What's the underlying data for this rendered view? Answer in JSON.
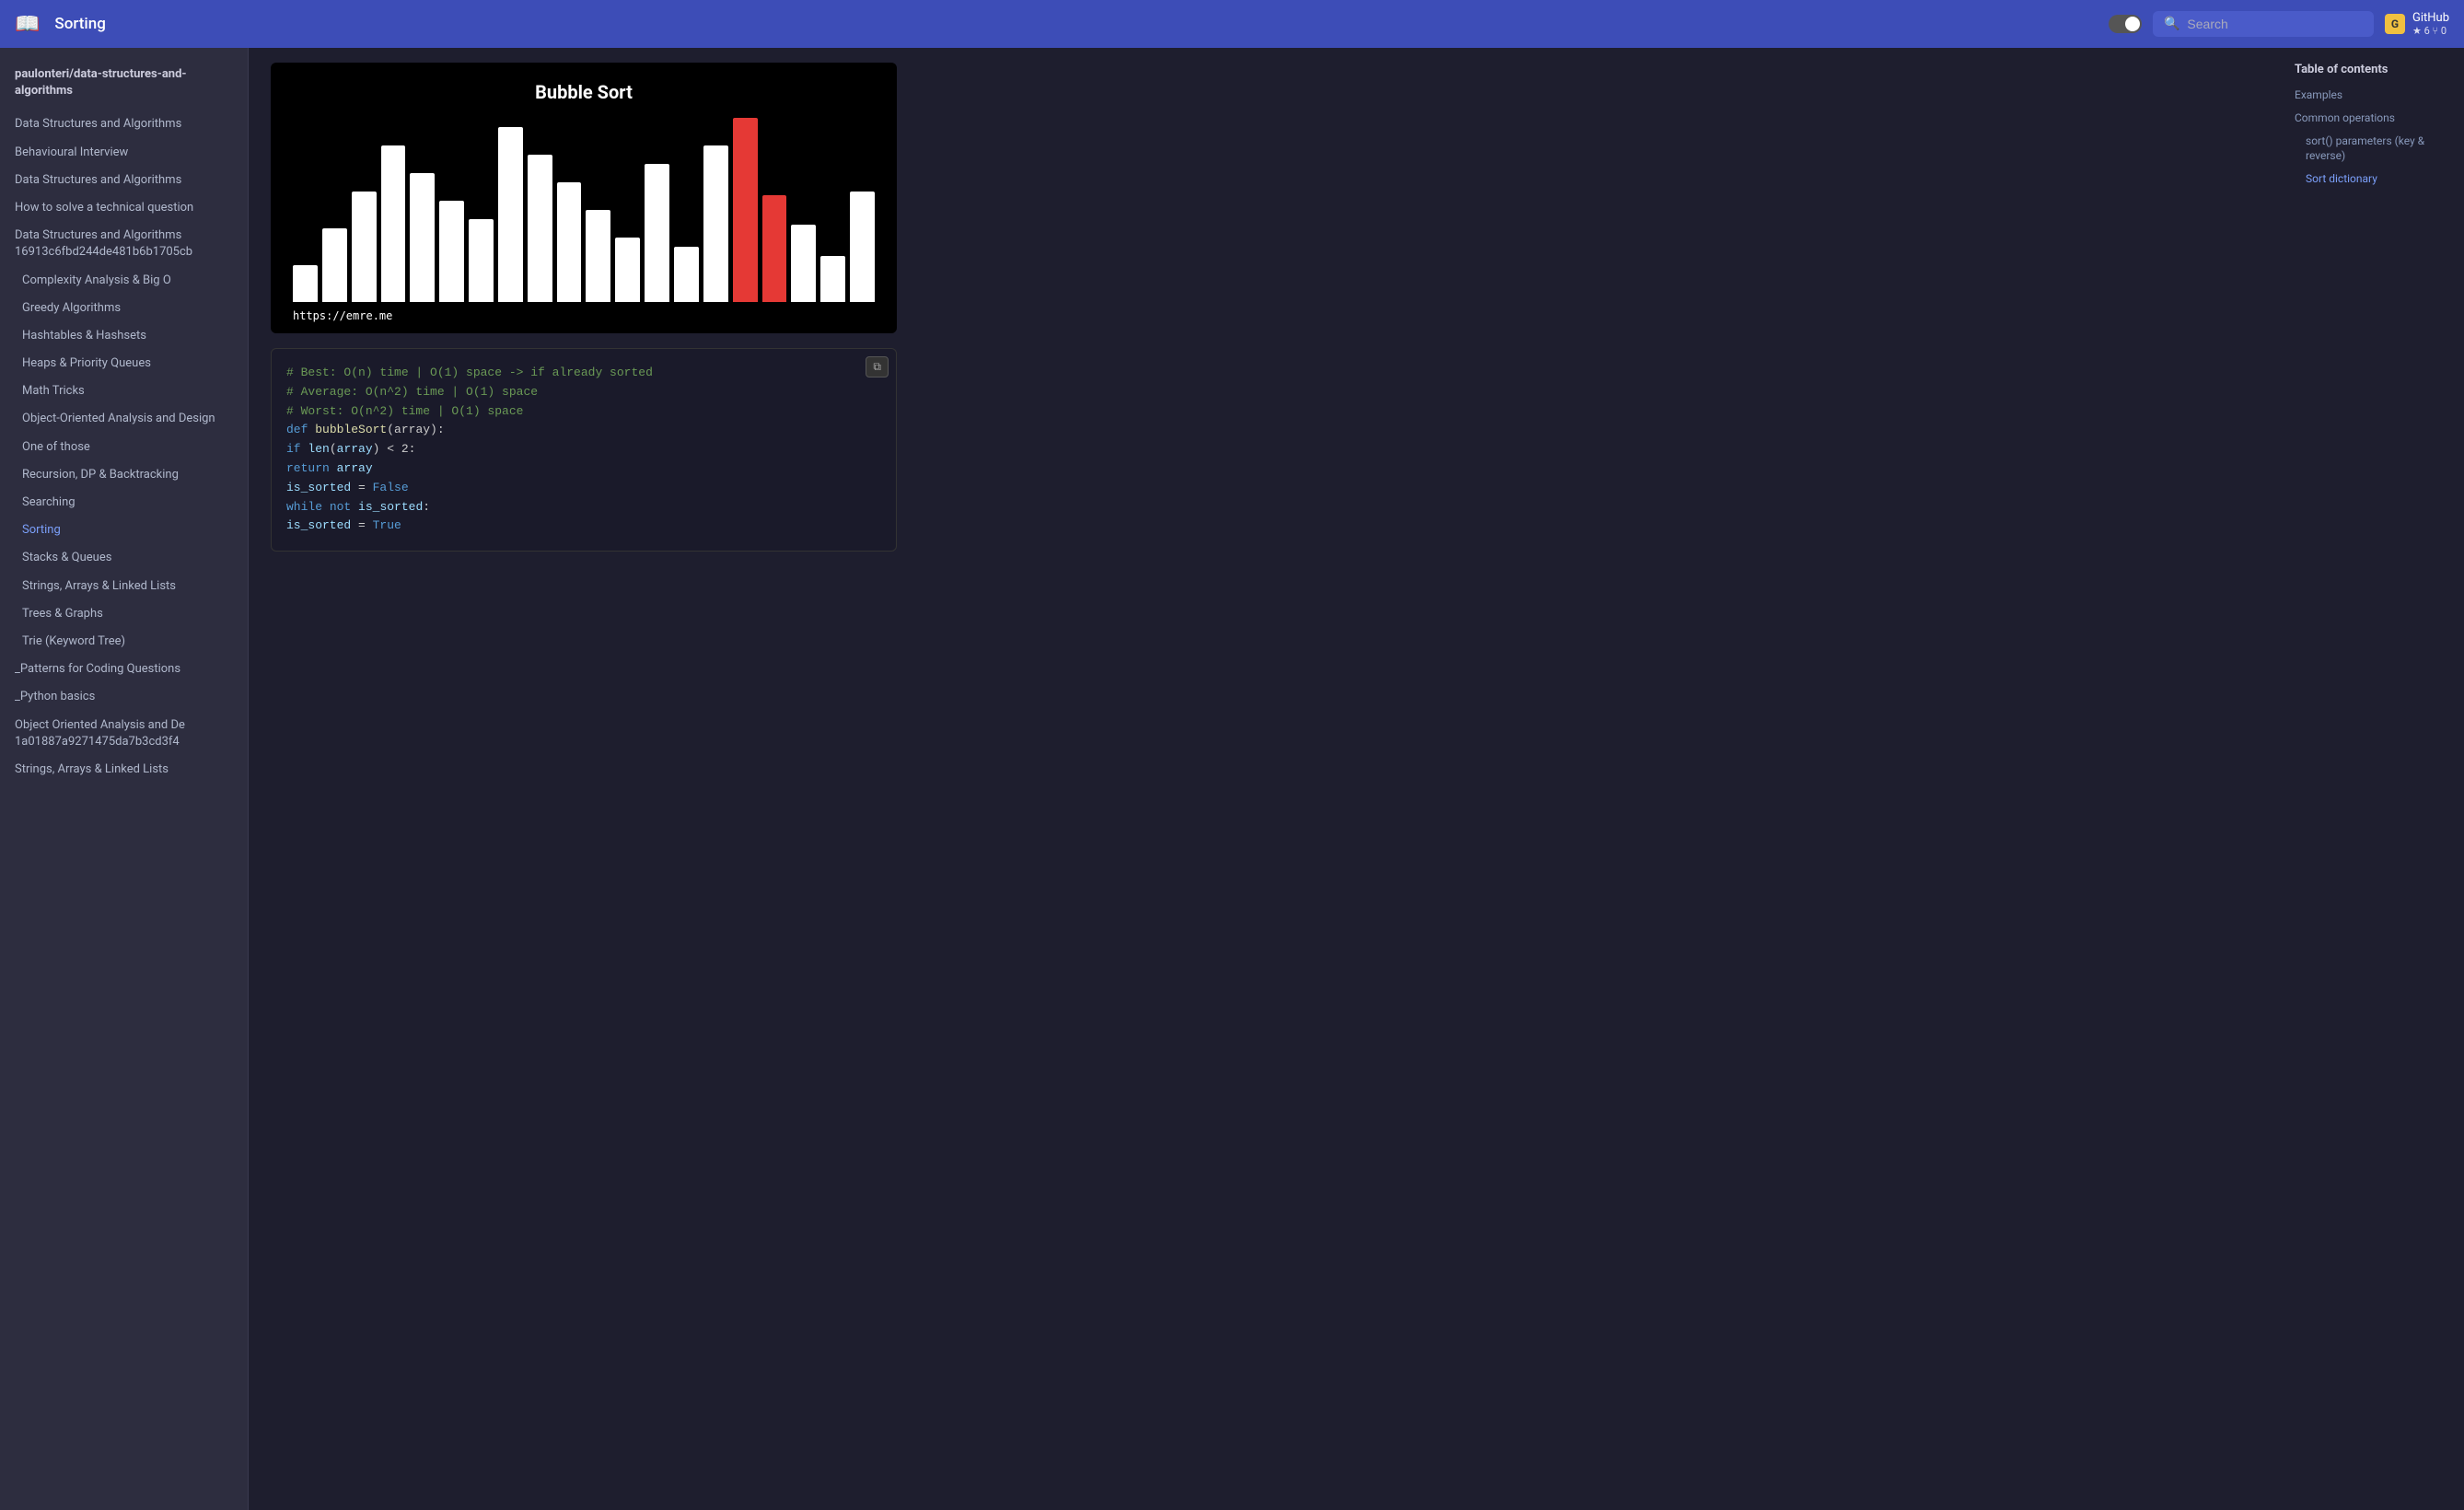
{
  "header": {
    "logo": "📖",
    "title": "Sorting",
    "toggle_label": "toggle",
    "search_placeholder": "Search",
    "github_label": "GitHub",
    "github_stars": "★ 6",
    "github_forks": "⑂ 0"
  },
  "sidebar": {
    "repo": "paulonteri/data-structures-and-algorithms",
    "items": [
      {
        "label": "Data Structures and Algorithms",
        "indented": false,
        "active": false
      },
      {
        "label": "Behavioural Interview",
        "indented": false,
        "active": false
      },
      {
        "label": "Data Structures and Algorithms",
        "indented": false,
        "active": false
      },
      {
        "label": "How to solve a technical question",
        "indented": false,
        "active": false
      },
      {
        "label": "Data Structures and Algorithms 16913c6fbd244de481b6b1705cb",
        "indented": false,
        "active": false
      },
      {
        "label": "Complexity Analysis & Big O",
        "indented": true,
        "active": false
      },
      {
        "label": "Greedy Algorithms",
        "indented": true,
        "active": false
      },
      {
        "label": "Hashtables & Hashsets",
        "indented": true,
        "active": false
      },
      {
        "label": "Heaps & Priority Queues",
        "indented": true,
        "active": false
      },
      {
        "label": "Math Tricks",
        "indented": true,
        "active": false
      },
      {
        "label": "Object-Oriented Analysis and Design",
        "indented": true,
        "active": false
      },
      {
        "label": "One of those",
        "indented": true,
        "active": false
      },
      {
        "label": "Recursion, DP & Backtracking",
        "indented": true,
        "active": false
      },
      {
        "label": "Searching",
        "indented": true,
        "active": false
      },
      {
        "label": "Sorting",
        "indented": true,
        "active": true
      },
      {
        "label": "Stacks & Queues",
        "indented": true,
        "active": false
      },
      {
        "label": "Strings, Arrays & Linked Lists",
        "indented": true,
        "active": false
      },
      {
        "label": "Trees & Graphs",
        "indented": true,
        "active": false
      },
      {
        "label": "Trie (Keyword Tree)",
        "indented": true,
        "active": false
      },
      {
        "label": "_Patterns for Coding Questions",
        "indented": false,
        "active": false
      },
      {
        "label": "_Python basics",
        "indented": false,
        "active": false
      },
      {
        "label": "Object Oriented Analysis and De 1a01887a9271475da7b3cd3f4",
        "indented": false,
        "active": false
      },
      {
        "label": "Strings, Arrays & Linked Lists",
        "indented": false,
        "active": false
      }
    ]
  },
  "chart": {
    "title": "Bubble Sort",
    "url": "https://emre.me",
    "bars": [
      {
        "height": 20,
        "red": false
      },
      {
        "height": 40,
        "red": false
      },
      {
        "height": 60,
        "red": false
      },
      {
        "height": 85,
        "red": false
      },
      {
        "height": 70,
        "red": false
      },
      {
        "height": 55,
        "red": false
      },
      {
        "height": 45,
        "red": false
      },
      {
        "height": 95,
        "red": false
      },
      {
        "height": 80,
        "red": false
      },
      {
        "height": 65,
        "red": false
      },
      {
        "height": 50,
        "red": false
      },
      {
        "height": 35,
        "red": false
      },
      {
        "height": 75,
        "red": false
      },
      {
        "height": 30,
        "red": false
      },
      {
        "height": 85,
        "red": false
      },
      {
        "height": 100,
        "red": true
      },
      {
        "height": 58,
        "red": true
      },
      {
        "height": 42,
        "red": false
      },
      {
        "height": 25,
        "red": false
      },
      {
        "height": 60,
        "red": false
      }
    ]
  },
  "code": {
    "lines": [
      {
        "text": "# Best: O(n) time | O(1) space -> if already sorted",
        "type": "comment"
      },
      {
        "text": "# Average: O(n^2) time | O(1) space",
        "type": "comment"
      },
      {
        "text": "# Worst: O(n^2) time | O(1) space",
        "type": "comment"
      },
      {
        "text": "def bubbleSort(array):",
        "type": "def"
      },
      {
        "text": "    if len(array) < 2:",
        "type": "keyword"
      },
      {
        "text": "        return array",
        "type": "keyword"
      },
      {
        "text": "",
        "type": "blank"
      },
      {
        "text": "    is_sorted = False",
        "type": "var"
      },
      {
        "text": "    while not is_sorted:",
        "type": "keyword"
      },
      {
        "text": "        is_sorted = True",
        "type": "var"
      }
    ],
    "copy_label": "⧉"
  },
  "toc": {
    "title": "Table of contents",
    "items": [
      {
        "label": "Examples",
        "indented": false,
        "active": false
      },
      {
        "label": "Common operations",
        "indented": false,
        "active": false
      },
      {
        "label": "sort() parameters (key & reverse)",
        "indented": true,
        "active": false
      },
      {
        "label": "Sort dictionary",
        "indented": true,
        "active": true
      }
    ]
  }
}
